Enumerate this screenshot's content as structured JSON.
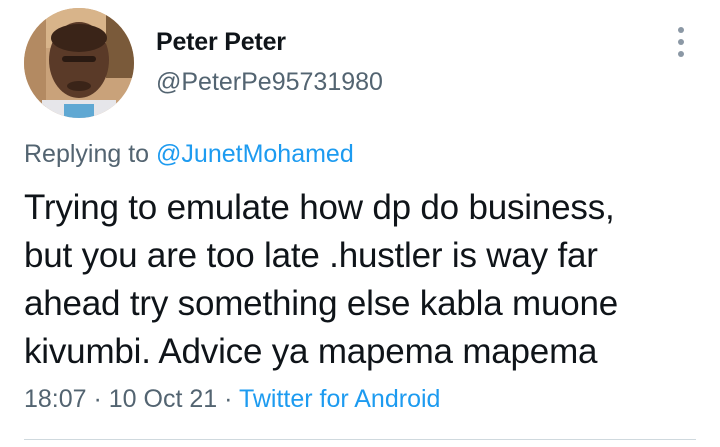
{
  "author": {
    "display_name": "Peter Peter",
    "handle": "@PeterPe95731980"
  },
  "reply": {
    "prefix": "Replying to ",
    "mention": "@JunetMohamed"
  },
  "tweet": {
    "text": "Trying to emulate how dp do business,\nbut you are too late .hustler is way far\nahead try something else kabla muone\nkivumbi. Advice ya mapema mapema"
  },
  "meta": {
    "time": "18:07",
    "separator1": " · ",
    "date": "10 Oct 21",
    "separator2": " · ",
    "source": "Twitter for Android"
  },
  "icons": {
    "more": "more-vertical-icon"
  },
  "colors": {
    "link": "#1d9bf0",
    "secondary_text": "#536471",
    "primary_text": "#0f1419"
  }
}
